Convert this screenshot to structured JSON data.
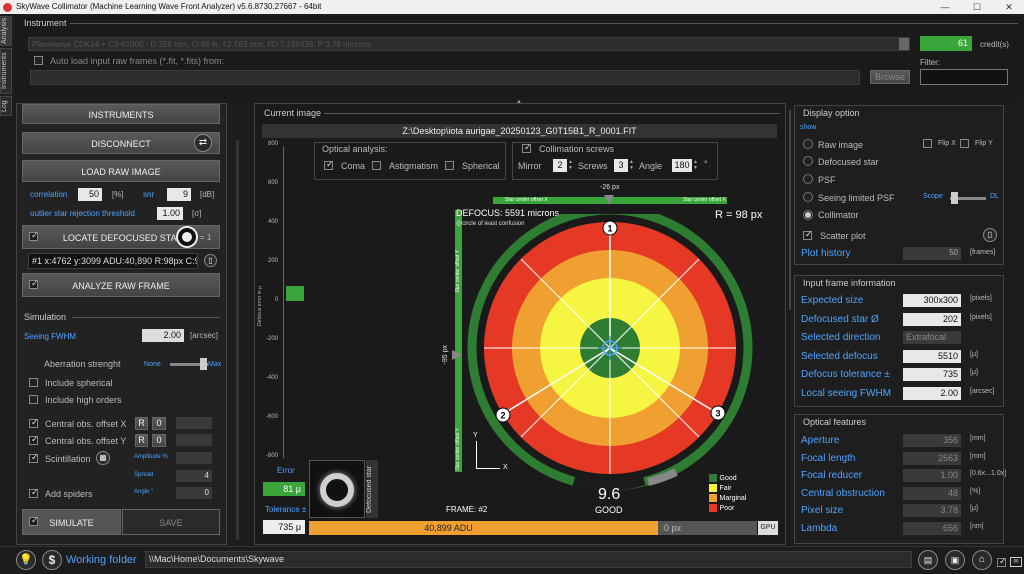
{
  "window": {
    "title": "SkyWave Collimator (Machine Learning Wave Front Analyzer) v5.6.8730.27667 - 64bit",
    "minimize": "—",
    "maximize": "☐",
    "close": "✕"
  },
  "side_tabs": [
    "Analysis",
    "Instruments",
    "Log"
  ],
  "instrument": {
    "header": "Instrument",
    "telescope": "Planewave CDK14 + C3-61000 - D:356 mm, O:48 %, f:2,563 mm, f/D:7.199438, P:3.78 microns",
    "credits_value": "61",
    "credits_label": "credit(s)",
    "auto_load_label": "Auto load input raw frames (*.fit, *.fits) from:",
    "browse": "Browse",
    "filter_label": "Filter:"
  },
  "left": {
    "instruments_btn": "INSTRUMENTS",
    "disconnect_btn": "DISCONNECT",
    "load_btn": "LOAD RAW IMAGE",
    "correlation_label": "correlation",
    "correlation_value": "50",
    "correlation_unit": "[%]",
    "snr_label": "snr",
    "snr_value": "9",
    "snr_unit": "[dB]",
    "outlier_label": "outlier star rejection threshold",
    "outlier_value": "1.00",
    "outlier_unit": "[σ]",
    "locate_btn": "LOCATE DEFOCUSED STARS",
    "locate_count": "= 1",
    "star_entry": "#1 x:4762 y:3099 ADU:40,890 R:98px C:97",
    "analyze_btn": "ANALYZE RAW FRAME",
    "simulation_header": "Simulation",
    "seeing_label": "Seeing FWHM",
    "seeing_value": "2.00",
    "seeing_unit": "[arcsec]",
    "aberration_label": "Aberration strenght",
    "none_label": "None",
    "max_label": "Max",
    "include_spherical": "Include spherical",
    "include_high": "Include high orders",
    "central_x": "Central obs. offset X",
    "central_y": "Central obs. offset Y",
    "r_label": "R",
    "zero": "0",
    "scintillation": "Scintillation",
    "amplitude": "Amplitude %",
    "spread": "Spread",
    "spread_value": "4",
    "add_spiders": "Add spiders",
    "angle": "Angle °",
    "angle_value": "0",
    "simulate_btn": "SIMULATE",
    "save_btn": "SAVE"
  },
  "center": {
    "header": "Current image",
    "file": "Z:\\Desktop\\iota aurigae_20250123_G0T15B1_R_0001.FIT",
    "optical_analysis": "Optical analysis:",
    "coma": "Coma",
    "astigmatism": "Astigmatism",
    "spherical": "Spherical",
    "collimation_screws": "Collimation screws",
    "mirror": "Mirror",
    "mirror_value": "2",
    "screws": "Screws",
    "screws_value": "3",
    "angle": "Angle",
    "angle_value": "180",
    "deg": "°",
    "yaxis_title": "Defocus error in μ",
    "yticks": [
      "800",
      "600",
      "400",
      "200",
      "0",
      "-200",
      "-400",
      "-600",
      "-800"
    ],
    "error_label": "Error",
    "error_value": "81 μ",
    "tolerance_label": "Tolerance ±",
    "tolerance_value": "735 μ",
    "defocused_star_label": "Defocused star",
    "top_offset": "-26 px",
    "left_offset": "-95 px",
    "star_center_x": "Star center offset X",
    "star_center_y": "Star center offset Y",
    "defocus": "DEFOCUS: 5591 microns",
    "circle_confusion": "@circle of least confusion",
    "radius": "R = 98 px",
    "score": "9.6",
    "score_label": "GOOD",
    "frame": "FRAME: #2",
    "legend": [
      {
        "label": "Good",
        "color": "#2e7d32"
      },
      {
        "label": "Fair",
        "color": "#f5f542"
      },
      {
        "label": "Marginal",
        "color": "#f0a030"
      },
      {
        "label": "Poor",
        "color": "#e53925"
      }
    ],
    "adu": "40,899 ADU",
    "adu_fraction": 0.78,
    "px_value": "0 px",
    "gpu": "GPU",
    "screw_marks": [
      "1",
      "2",
      "3"
    ],
    "axis_x": "X",
    "axis_y": "Y"
  },
  "right": {
    "display_header": "Display option",
    "show": "show",
    "raw_image": "Raw image",
    "defocused_star": "Defocused star",
    "psf": "PSF",
    "seeing_psf": "Seeing limited PSF",
    "collimator": "Collimator",
    "flip_x": "Flip X",
    "flip_y": "Flip Y",
    "scope": "Scope",
    "dl": "DL",
    "scatter_plot": "Scatter plot",
    "plot_history": "Plot history",
    "plot_history_value": "50",
    "frames_unit": "[frames]",
    "input_header": "Input frame information",
    "input_rows": [
      {
        "label": "Expected size",
        "value": "300x300",
        "unit": "[pixels]"
      },
      {
        "label": "Defocused star Ø",
        "value": "202",
        "unit": "[pixels]"
      },
      {
        "label": "Selected direction",
        "value": "Extrafocal",
        "unit": ""
      },
      {
        "label": "Selected defocus",
        "value": "5510",
        "unit": "[μ]"
      },
      {
        "label": "Defocus tolerance ±",
        "value": "735",
        "unit": "[μ]"
      },
      {
        "label": "Local seeing FWHM",
        "value": "2.00",
        "unit": "[arcsec]"
      }
    ],
    "optical_header": "Optical features",
    "optical_rows": [
      {
        "label": "Aperture",
        "value": "356",
        "unit": "[mm]"
      },
      {
        "label": "Focal length",
        "value": "2563",
        "unit": "[mm]"
      },
      {
        "label": "Focal reducer",
        "value": "1.00",
        "unit": "[0.6x...1.0x]"
      },
      {
        "label": "Central obstruction",
        "value": "48",
        "unit": "[%]"
      },
      {
        "label": "Pixel size",
        "value": "3.78",
        "unit": "[μ]"
      },
      {
        "label": "Lambda",
        "value": "656",
        "unit": "[nm]"
      }
    ]
  },
  "footer": {
    "working_folder_label": "Working folder",
    "working_folder_path": "\\\\Mac\\Home\\Documents\\Skywave"
  }
}
